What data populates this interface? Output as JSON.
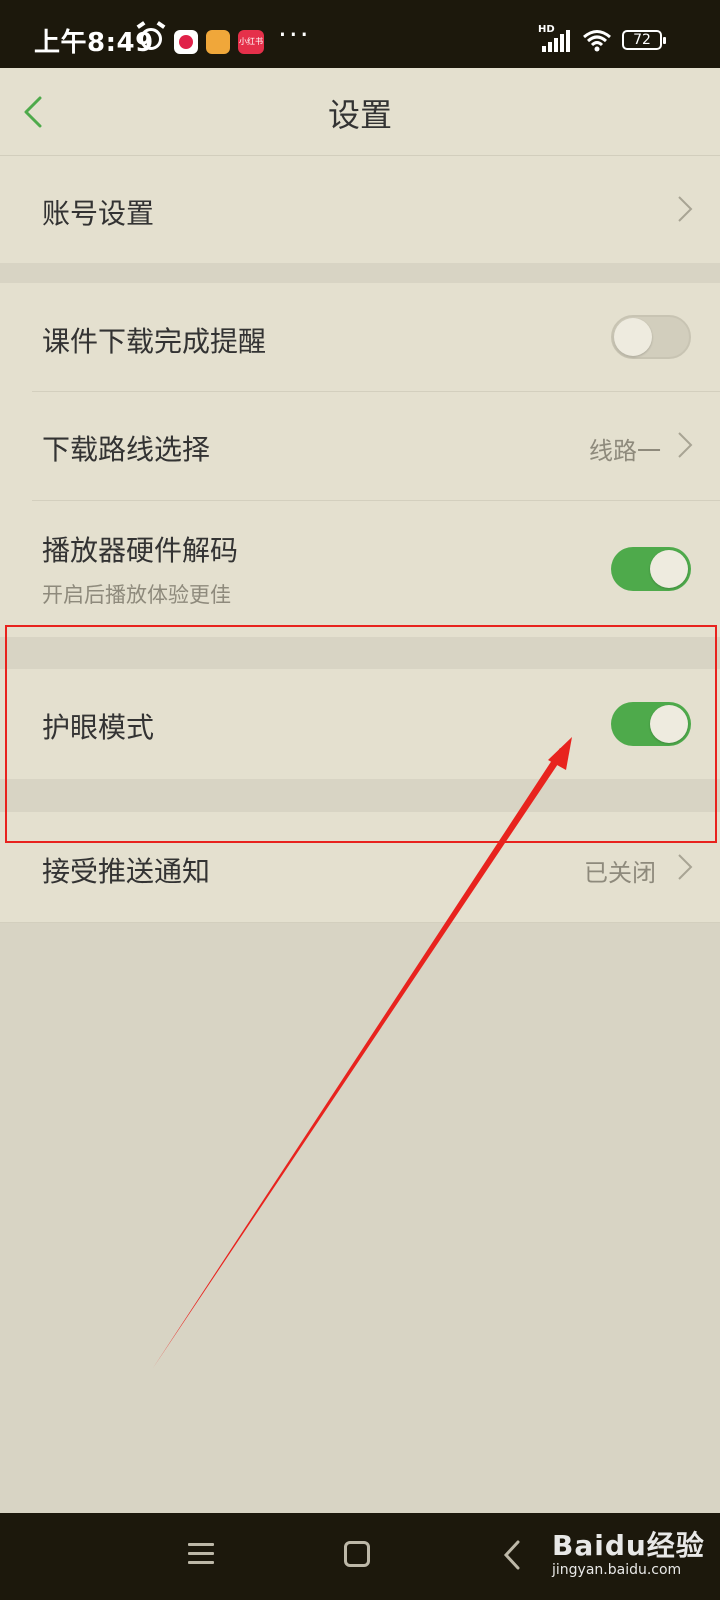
{
  "status_bar": {
    "time": "上午8:49",
    "network_label": "HD",
    "battery": "72",
    "more": "···",
    "app3_label": "小红书"
  },
  "header": {
    "title": "设置",
    "back_icon": "chevron-left-icon"
  },
  "settings": {
    "account": {
      "label": "账号设置"
    },
    "download_reminder": {
      "label": "课件下载完成提醒",
      "enabled": false
    },
    "download_route": {
      "label": "下载路线选择",
      "value": "线路一"
    },
    "hardware_decode": {
      "label": "播放器硬件解码",
      "subtitle": "开启后播放体验更佳",
      "enabled": true
    },
    "eye_care": {
      "label": "护眼模式",
      "enabled": true
    },
    "push": {
      "label": "接受推送通知",
      "value": "已关闭"
    }
  },
  "watermark": {
    "title": "Baidu经验",
    "url": "jingyan.baidu.com"
  },
  "colors": {
    "accent": "#4eaa4b",
    "background": "#d8d4c4",
    "card": "#e4e0cf",
    "annotation": "#e8231e"
  }
}
